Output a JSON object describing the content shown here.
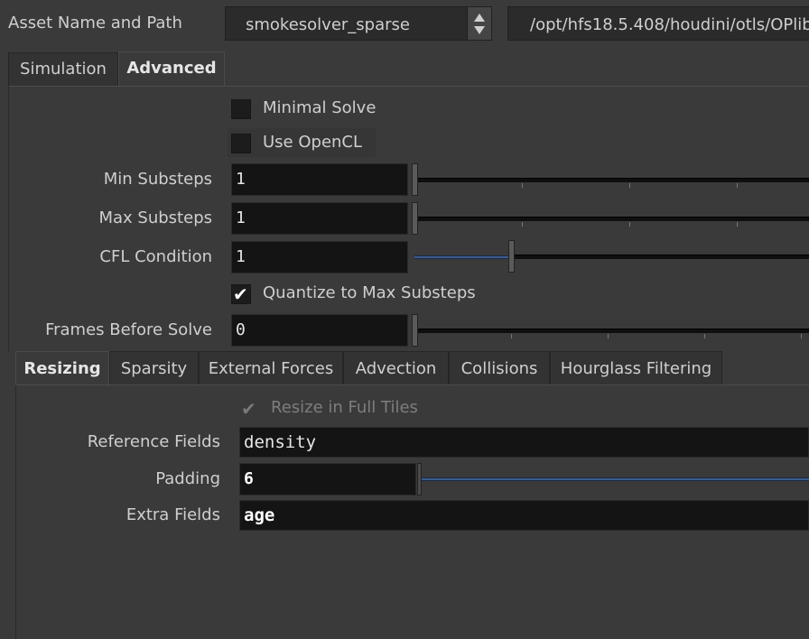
{
  "header": {
    "label": "Asset Name and Path",
    "asset_name": "smokesolver_sparse",
    "asset_path": "/opt/hfs18.5.408/houdini/otls/OPlib"
  },
  "top_tabs": [
    "Simulation",
    "Advanced"
  ],
  "advanced": {
    "minimal_solve": {
      "label": "Minimal Solve",
      "checked": false
    },
    "use_opencl": {
      "label": "Use OpenCL",
      "checked": false
    },
    "min_substeps": {
      "label": "Min Substeps",
      "value": "1"
    },
    "max_substeps": {
      "label": "Max Substeps",
      "value": "1"
    },
    "cfl_condition": {
      "label": "CFL Condition",
      "value": "1"
    },
    "quantize": {
      "label": "Quantize to Max Substeps",
      "checked": true
    },
    "frames_before_solve": {
      "label": "Frames Before Solve",
      "value": "0"
    }
  },
  "lower_tabs": [
    "Resizing",
    "Sparsity",
    "External Forces",
    "Advection",
    "Collisions",
    "Hourglass Filtering"
  ],
  "resizing": {
    "resize_full_tiles": {
      "label": "Resize in Full Tiles",
      "checked": true,
      "disabled": true
    },
    "reference_fields": {
      "label": "Reference Fields",
      "value": "density"
    },
    "padding": {
      "label": "Padding",
      "value": "6"
    },
    "extra_fields": {
      "label": "Extra Fields",
      "value": "age"
    }
  },
  "colors": {
    "background": "#3a3a3a",
    "field": "#141414",
    "slider_accent": "#3b5c8c"
  }
}
